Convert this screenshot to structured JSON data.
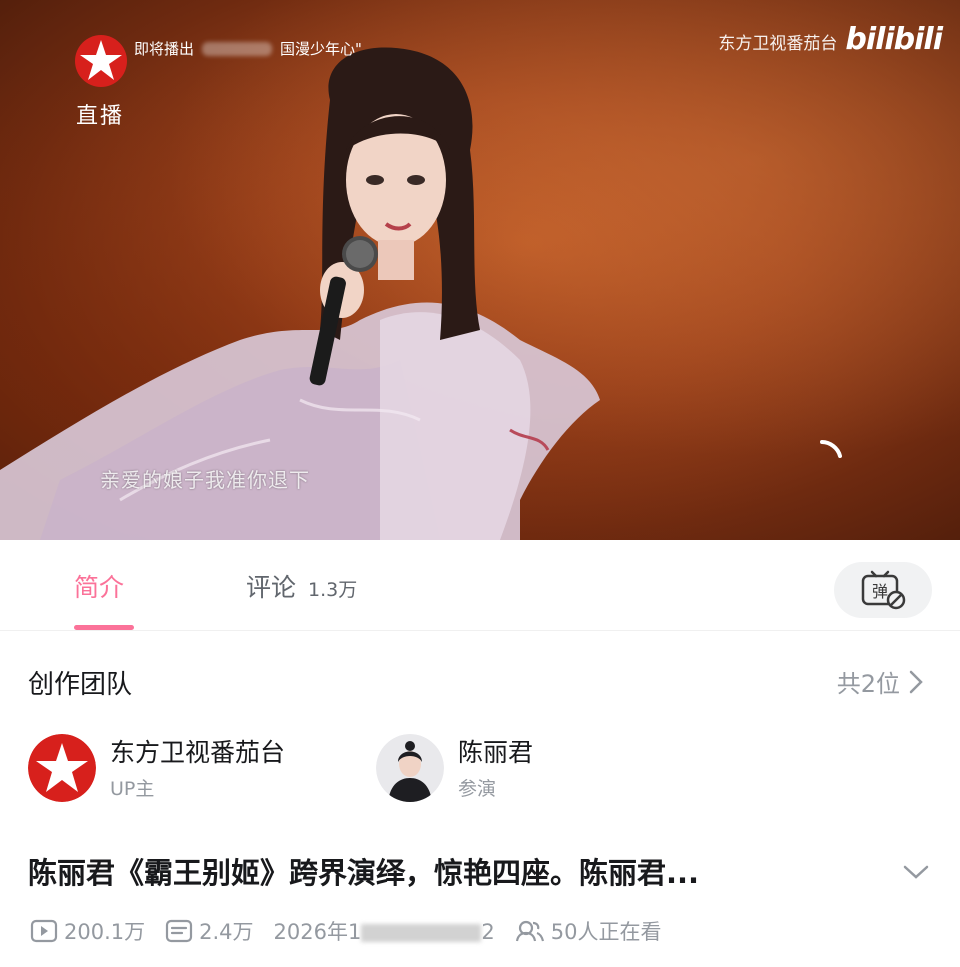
{
  "video": {
    "channel_logo_label": "直播",
    "upcoming_prefix": "即将播出",
    "upcoming_show": "国漫少年心\"",
    "station_name": "东方卫视番茄台",
    "platform_logo": "bilibili",
    "lyric_subtitle": "亲爱的娘子我准你退下"
  },
  "tabs": {
    "intro_label": "简介",
    "comments_label": "评论",
    "comments_count": "1.3万",
    "danmaku_icon": "弹"
  },
  "team": {
    "title": "创作团队",
    "count_label": "共2位",
    "members": [
      {
        "name": "东方卫视番茄台",
        "role": "UP主"
      },
      {
        "name": "陈丽君",
        "role": "参演"
      }
    ]
  },
  "title": "陈丽君《霸王别姬》跨界演绎，惊艳四座。陈丽君...",
  "stats": {
    "plays": "200.1万",
    "danmaku": "2.4万",
    "date_prefix": "2026年1",
    "date_suffix": "2",
    "watching": "50人正在看"
  },
  "colors": {
    "accent": "#fb7299",
    "text_primary": "#18191c",
    "text_secondary": "#9499a0",
    "logo_red": "#d7201c"
  }
}
